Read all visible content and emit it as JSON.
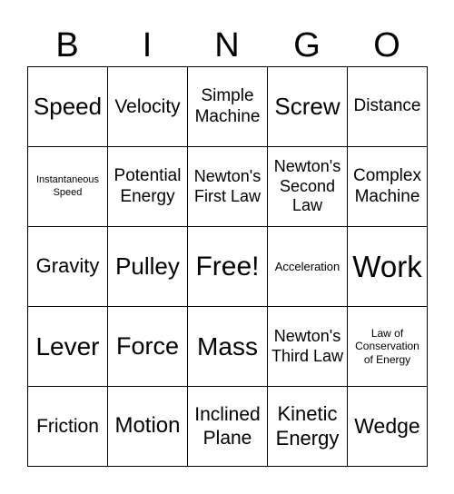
{
  "header": [
    "B",
    "I",
    "N",
    "G",
    "O"
  ],
  "cells": [
    "Speed",
    "Velocity",
    "Simple Machine",
    "Screw",
    "Distance",
    "Instantaneous Speed",
    "Potential Energy",
    "Newton's First Law",
    "Newton's Second Law",
    "Complex Machine",
    "Gravity",
    "Pulley",
    "Free!",
    "Acceleration",
    "Work",
    "Lever",
    "Force",
    "Mass",
    "Newton's Third Law",
    "Law of Conservation of Energy",
    "Friction",
    "Motion",
    "Inclined Plane",
    "Kinetic Energy",
    "Wedge"
  ]
}
